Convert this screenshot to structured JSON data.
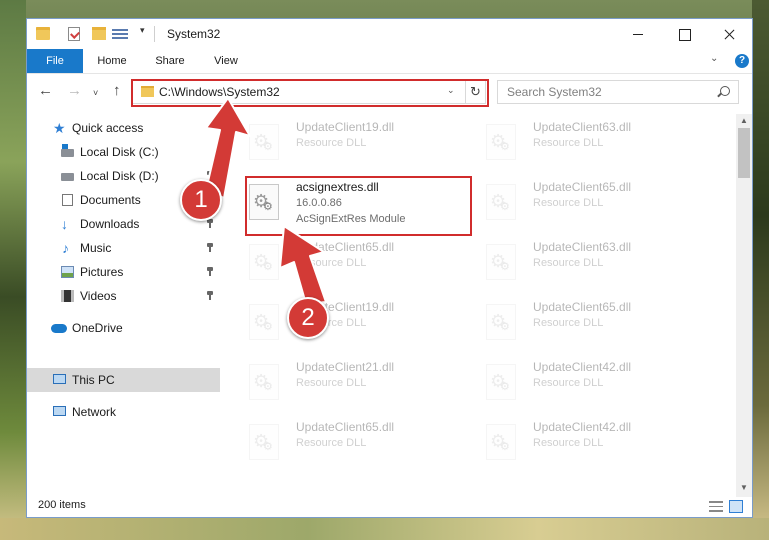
{
  "window": {
    "title": "System32"
  },
  "ribbon": {
    "tabs": [
      "File",
      "Home",
      "Share",
      "View"
    ],
    "expand_icon": "chevron-down-icon",
    "help_label": "?"
  },
  "navigation": {
    "back_glyph": "←",
    "forward_glyph": "→",
    "recent_glyph": "˅",
    "up_glyph": "↑",
    "address": "C:\\Windows\\System32",
    "refresh_glyph": "↻",
    "search_placeholder": "Search System32"
  },
  "sidebar": {
    "items": [
      {
        "label": "Quick access",
        "icon": "star-icon",
        "pinned": false
      },
      {
        "label": "Local Disk (C:)",
        "icon": "disk-c-icon",
        "pinned": false
      },
      {
        "label": "Local Disk (D:)",
        "icon": "disk-icon",
        "pinned": true
      },
      {
        "label": "Documents",
        "icon": "documents-icon",
        "pinned": true
      },
      {
        "label": "Downloads",
        "icon": "downloads-icon",
        "pinned": true
      },
      {
        "label": "Music",
        "icon": "music-icon",
        "pinned": true
      },
      {
        "label": "Pictures",
        "icon": "pictures-icon",
        "pinned": true
      },
      {
        "label": "Videos",
        "icon": "videos-icon",
        "pinned": true
      },
      {
        "label": "OneDrive",
        "icon": "onedrive-icon",
        "pinned": false
      },
      {
        "label": "This PC",
        "icon": "this-pc-icon",
        "pinned": false,
        "selected": true
      },
      {
        "label": "Network",
        "icon": "network-icon",
        "pinned": false
      }
    ]
  },
  "files": {
    "left_column": [
      {
        "name": "UpdateClient19.dll",
        "type": "Resource DLL"
      },
      {
        "name": "acsignextres.dll",
        "type": "16.0.0.86",
        "extra": "AcSignExtRes Module",
        "highlighted": true
      },
      {
        "name": "UpdateClient65.dll",
        "type": "Resource DLL"
      },
      {
        "name": "UpdateClient19.dll",
        "type": "Resource DLL"
      },
      {
        "name": "UpdateClient21.dll",
        "type": "Resource DLL"
      },
      {
        "name": "UpdateClient65.dll",
        "type": "Resource DLL"
      }
    ],
    "right_column": [
      {
        "name": "UpdateClient63.dll",
        "type": "Resource DLL"
      },
      {
        "name": "UpdateClient65.dll",
        "type": "Resource DLL"
      },
      {
        "name": "UpdateClient63.dll",
        "type": "Resource DLL"
      },
      {
        "name": "UpdateClient65.dll",
        "type": "Resource DLL"
      },
      {
        "name": "UpdateClient42.dll",
        "type": "Resource DLL"
      },
      {
        "name": "UpdateClient42.dll",
        "type": "Resource DLL"
      }
    ]
  },
  "status": {
    "item_count": "200 items"
  },
  "annotations": {
    "step1": "1",
    "step2": "2",
    "highlight_color": "#d12c2c",
    "marker_color": "#d33a36"
  },
  "colors": {
    "accent": "#1979ca"
  }
}
